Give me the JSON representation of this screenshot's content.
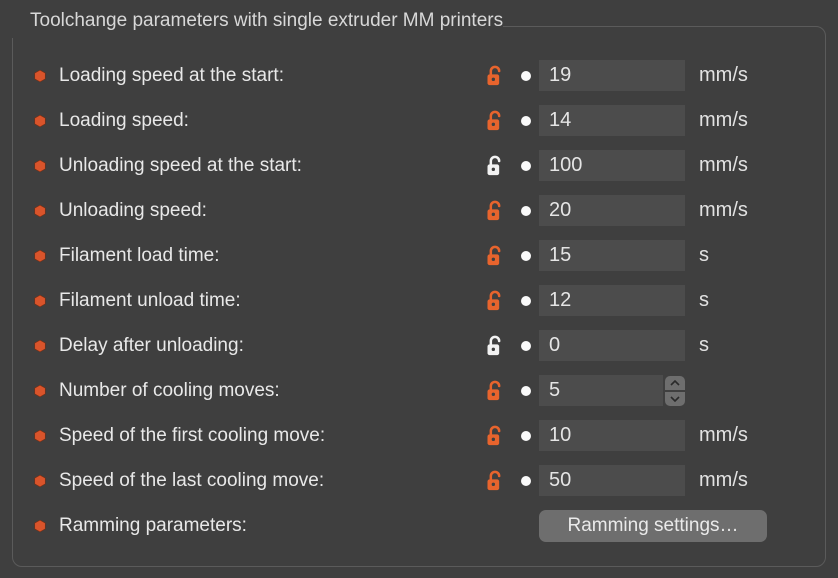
{
  "section_title": "Toolchange parameters with single extruder MM printers",
  "colors": {
    "bullet": "#d9542b",
    "lock_orange": "#e8642d",
    "lock_white": "#f2f2f2"
  },
  "rows": [
    {
      "id": "loading-speed-start",
      "label": "Loading speed at the start:",
      "lock": "orange",
      "value": "19",
      "unit": "mm/s",
      "type": "text"
    },
    {
      "id": "loading-speed",
      "label": "Loading speed:",
      "lock": "orange",
      "value": "14",
      "unit": "mm/s",
      "type": "text"
    },
    {
      "id": "unloading-speed-start",
      "label": "Unloading speed at the start:",
      "lock": "white",
      "value": "100",
      "unit": "mm/s",
      "type": "text"
    },
    {
      "id": "unloading-speed",
      "label": "Unloading speed:",
      "lock": "orange",
      "value": "20",
      "unit": "mm/s",
      "type": "text"
    },
    {
      "id": "filament-load-time",
      "label": "Filament load time:",
      "lock": "orange",
      "value": "15",
      "unit": "s",
      "type": "text"
    },
    {
      "id": "filament-unload-time",
      "label": "Filament unload time:",
      "lock": "orange",
      "value": "12",
      "unit": "s",
      "type": "text"
    },
    {
      "id": "delay-after-unloading",
      "label": "Delay after unloading:",
      "lock": "white",
      "value": "0",
      "unit": "s",
      "type": "text"
    },
    {
      "id": "cooling-moves",
      "label": "Number of cooling moves:",
      "lock": "orange",
      "value": "5",
      "unit": "",
      "type": "stepper"
    },
    {
      "id": "first-cooling-speed",
      "label": "Speed of the first cooling move:",
      "lock": "orange",
      "value": "10",
      "unit": "mm/s",
      "type": "text"
    },
    {
      "id": "last-cooling-speed",
      "label": "Speed of the last cooling move:",
      "lock": "orange",
      "value": "50",
      "unit": "mm/s",
      "type": "text"
    },
    {
      "id": "ramming-params",
      "label": "Ramming parameters:",
      "lock": null,
      "button_label": "Ramming settings…",
      "type": "button"
    }
  ]
}
